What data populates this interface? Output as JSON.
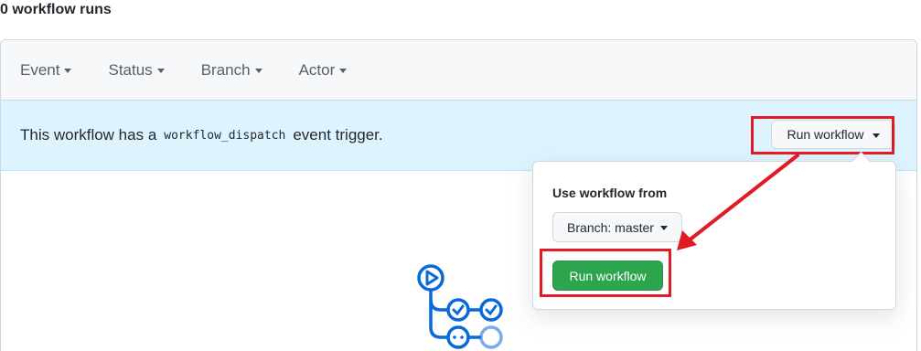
{
  "header": {
    "runs_count": "0 workflow runs"
  },
  "filters": [
    {
      "label": "Event"
    },
    {
      "label": "Status"
    },
    {
      "label": "Branch"
    },
    {
      "label": "Actor"
    }
  ],
  "dispatch": {
    "text_before": "This workflow has a",
    "code": "workflow_dispatch",
    "text_after": "event trigger.",
    "run_button_label": "Run workflow"
  },
  "dropdown": {
    "label": "Use workflow from",
    "branch_button_label": "Branch: master",
    "run_button_label": "Run workflow"
  },
  "colors": {
    "accent": "#0969da",
    "success": "#2da44e",
    "annotation": "#e01b24",
    "info_bg": "#ddf4ff"
  },
  "icons": {
    "empty_state": "actions-workflow-icon",
    "caret": "triangle-down-icon"
  }
}
